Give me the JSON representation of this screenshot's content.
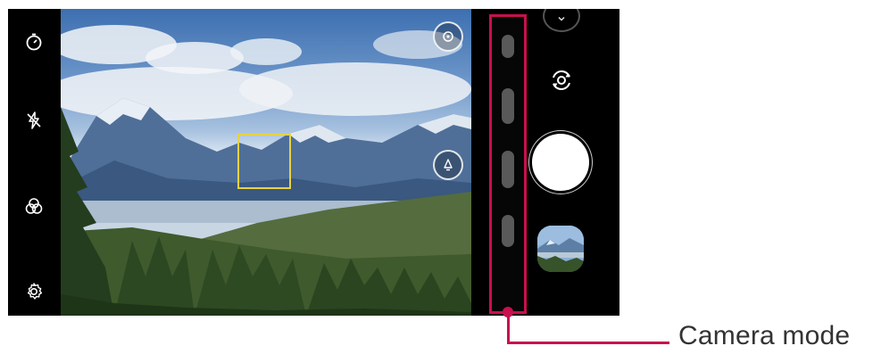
{
  "left_bar": {
    "icons": [
      "timer-icon",
      "flash-off-icon",
      "filter-icon",
      "settings-icon"
    ]
  },
  "viewfinder": {
    "top_button_icon": "focus-target-icon",
    "right_button_icon": "cheese-shutter-icon"
  },
  "right_panel": {
    "expand_icon": "chevron-down-icon",
    "switch_icon": "switch-camera-icon",
    "shutter_icon": "shutter-button",
    "gallery_icon": "gallery-thumbnail"
  },
  "callout": {
    "label": "Camera mode",
    "color": "#c8104e"
  },
  "colors": {
    "accent": "#c8104e",
    "focus_box": "#e6d247"
  }
}
